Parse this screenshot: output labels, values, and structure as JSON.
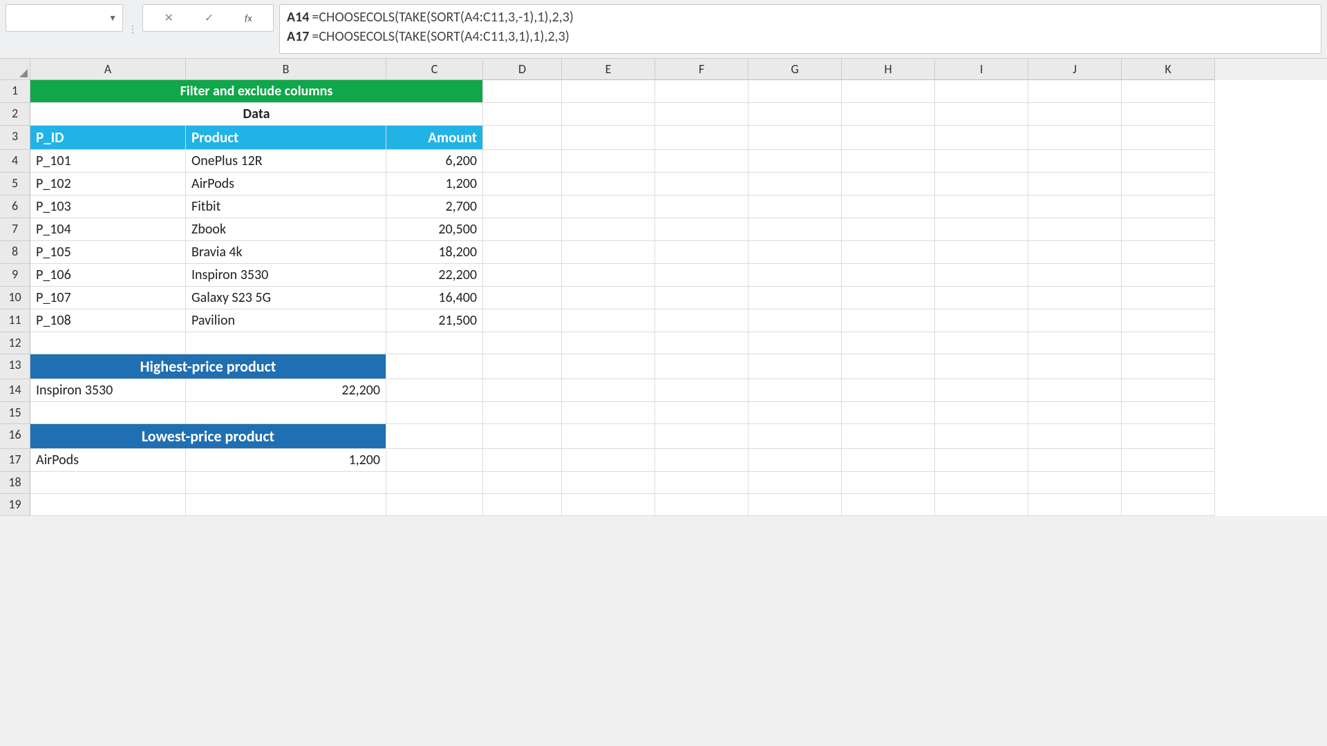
{
  "formula_bar": {
    "lines": [
      {
        "ref": "A14",
        "formula": "=CHOOSECOLS(TAKE(SORT(A4:C11,3,-1),1),2,3)"
      },
      {
        "ref": "A17",
        "formula": "=CHOOSECOLS(TAKE(SORT(A4:C11,3,1),1),2,3)"
      }
    ]
  },
  "columns": [
    "A",
    "B",
    "C",
    "D",
    "E",
    "F",
    "G",
    "H",
    "I",
    "J",
    "K"
  ],
  "rows": [
    "1",
    "2",
    "3",
    "4",
    "5",
    "6",
    "7",
    "8",
    "9",
    "10",
    "11",
    "12",
    "13",
    "14",
    "15",
    "16",
    "17",
    "18",
    "19"
  ],
  "a1": "Filter and exclude columns",
  "a2": "Data",
  "headers": {
    "pid": "P_ID",
    "product": "Product",
    "amount": "Amount"
  },
  "data": [
    {
      "pid": "P_101",
      "product": "OnePlus 12R",
      "amount": "6,200"
    },
    {
      "pid": "P_102",
      "product": "AirPods",
      "amount": "1,200"
    },
    {
      "pid": "P_103",
      "product": "Fitbit",
      "amount": "2,700"
    },
    {
      "pid": "P_104",
      "product": "Zbook",
      "amount": "20,500"
    },
    {
      "pid": "P_105",
      "product": "Bravia 4k",
      "amount": "18,200"
    },
    {
      "pid": "P_106",
      "product": "Inspiron 3530",
      "amount": "22,200"
    },
    {
      "pid": "P_107",
      "product": "Galaxy S23 5G",
      "amount": "16,400"
    },
    {
      "pid": "P_108",
      "product": "Pavilion",
      "amount": "21,500"
    }
  ],
  "sections": {
    "high_label": "Highest-price product",
    "high_product": "Inspiron 3530",
    "high_amount": "22,200",
    "low_label": "Lowest-price product",
    "low_product": "AirPods",
    "low_amount": "1,200"
  },
  "chart_data": {
    "type": "table",
    "title": "Filter and exclude columns",
    "columns": [
      "P_ID",
      "Product",
      "Amount"
    ],
    "rows": [
      [
        "P_101",
        "OnePlus 12R",
        6200
      ],
      [
        "P_102",
        "AirPods",
        1200
      ],
      [
        "P_103",
        "Fitbit",
        2700
      ],
      [
        "P_104",
        "Zbook",
        20500
      ],
      [
        "P_105",
        "Bravia 4k",
        18200
      ],
      [
        "P_106",
        "Inspiron 3530",
        22200
      ],
      [
        "P_107",
        "Galaxy S23 5G",
        16400
      ],
      [
        "P_108",
        "Pavilion",
        21500
      ]
    ],
    "derived": {
      "highest_price_product": {
        "product": "Inspiron 3530",
        "amount": 22200
      },
      "lowest_price_product": {
        "product": "AirPods",
        "amount": 1200
      }
    }
  }
}
